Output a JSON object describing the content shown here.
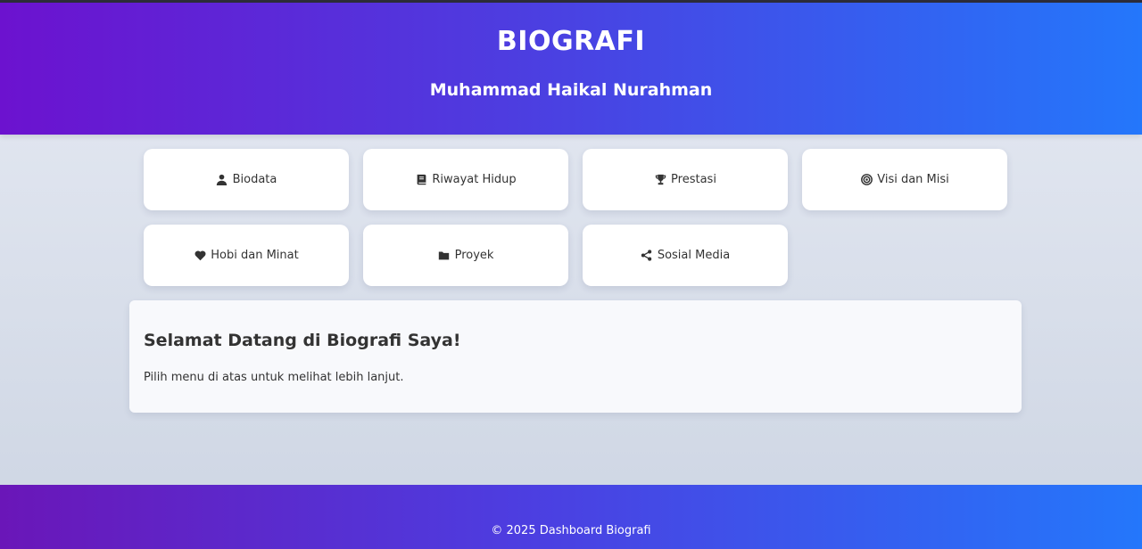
{
  "header": {
    "title": "BIOGRAFI",
    "subtitle": "Muhammad Haikal Nurahman"
  },
  "menu": [
    {
      "label": "Biodata",
      "icon": "user-icon"
    },
    {
      "label": "Riwayat Hidup",
      "icon": "book-icon"
    },
    {
      "label": "Prestasi",
      "icon": "trophy-icon"
    },
    {
      "label": "Visi dan Misi",
      "icon": "target-icon"
    },
    {
      "label": "Hobi dan Minat",
      "icon": "heart-icon"
    },
    {
      "label": "Proyek",
      "icon": "folder-icon"
    },
    {
      "label": "Sosial Media",
      "icon": "share-icon"
    }
  ],
  "welcome": {
    "heading": "Selamat Datang di Biografi Saya!",
    "text": "Pilih menu di atas untuk melihat lebih lanjut."
  },
  "footer": {
    "text": "© 2025 Dashboard Biografi"
  },
  "colors": {
    "header_gradient_start": "#6c12cf",
    "header_gradient_end": "#2477fb",
    "card_background": "#ffffff",
    "text": "#333333"
  }
}
